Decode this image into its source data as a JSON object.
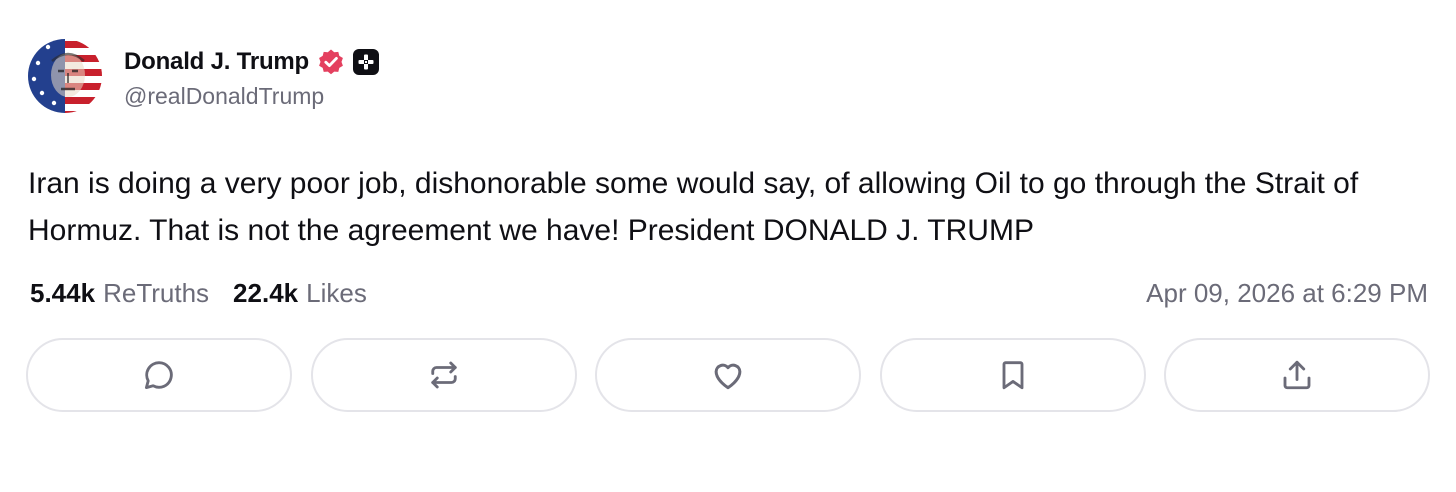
{
  "author": {
    "display_name": "Donald J. Trump",
    "handle": "@realDonaldTrump",
    "avatar_icon": "avatar-flag-portrait",
    "verified_icon": "verified-badge-icon",
    "plus_icon": "plus-badge-icon"
  },
  "post": {
    "text": "Iran is doing a very poor job, dishonorable some would say, of allowing Oil to go through the Strait of Hormuz. That is not the agreement we have! President DONALD J. TRUMP"
  },
  "stats": {
    "retruths_count": "5.44k",
    "retruths_label": "ReTruths",
    "likes_count": "22.4k",
    "likes_label": "Likes",
    "timestamp": "Apr 09, 2026 at 6:29 PM"
  },
  "actions": [
    {
      "icon": "reply-icon"
    },
    {
      "icon": "retruth-icon"
    },
    {
      "icon": "like-icon"
    },
    {
      "icon": "bookmark-icon"
    },
    {
      "icon": "share-icon"
    }
  ],
  "colors": {
    "text_primary": "#0f0f14",
    "text_secondary": "#6b6b78",
    "verified_pink": "#e4405f",
    "button_border": "#e4e4e9"
  }
}
